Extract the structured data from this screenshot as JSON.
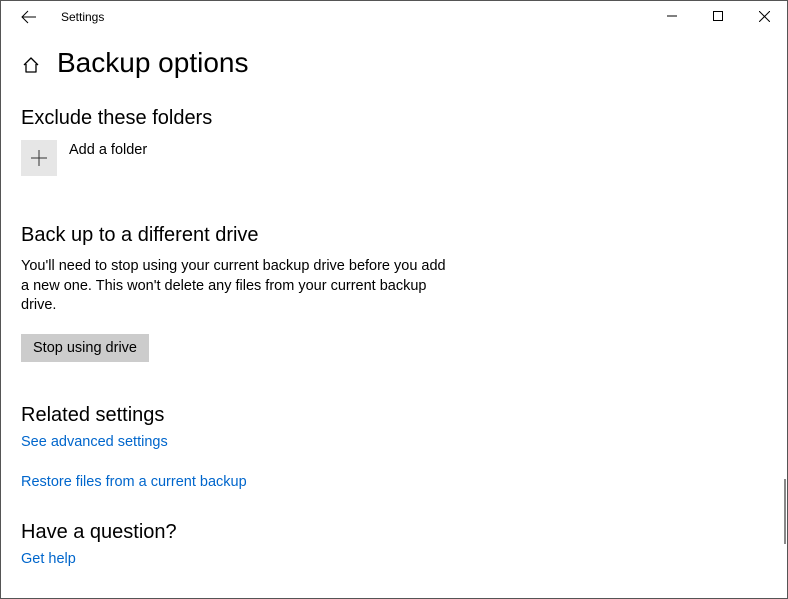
{
  "window": {
    "title": "Settings"
  },
  "page": {
    "title": "Backup options"
  },
  "exclude": {
    "heading": "Exclude these folders",
    "add_label": "Add a folder"
  },
  "different_drive": {
    "heading": "Back up to a different drive",
    "body": "You'll need to stop using your current backup drive before you add a new one. This won't delete any files from your current backup drive.",
    "button": "Stop using drive"
  },
  "related": {
    "heading": "Related settings",
    "link1": "See advanced settings",
    "link2": "Restore files from a current backup"
  },
  "question": {
    "heading": "Have a question?",
    "link": "Get help"
  }
}
